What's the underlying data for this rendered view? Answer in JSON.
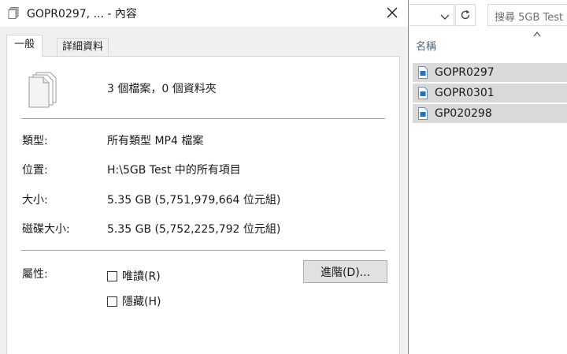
{
  "dialog": {
    "title": "GOPR0297, ... - 內容",
    "tabs": [
      {
        "label": "一般",
        "active": true
      },
      {
        "label": "詳細資料",
        "active": false
      }
    ],
    "summary": "3 個檔案，0 個資料夾",
    "rows": {
      "type": {
        "label": "類型:",
        "value": "所有類型 MP4 檔案"
      },
      "location": {
        "label": "位置:",
        "value": "H:\\5GB Test 中的所有項目"
      },
      "size": {
        "label": "大小:",
        "value": "5.35 GB (5,751,979,664 位元組)"
      },
      "size_on_disk": {
        "label": "磁碟大小:",
        "value": "5.35 GB (5,752,225,792 位元組)"
      }
    },
    "attributes": {
      "label": "屬性:",
      "readonly": {
        "label": "唯讀(R)",
        "checked": false
      },
      "hidden": {
        "label": "隱藏(H)",
        "checked": false
      },
      "advanced_label": "進階(D)..."
    }
  },
  "explorer": {
    "search_placeholder": "搜尋 5GB Test",
    "column_header": "名稱",
    "files": [
      {
        "name": "GOPR0297",
        "selected": true
      },
      {
        "name": "GOPR0301",
        "selected": true
      },
      {
        "name": "GP020298",
        "selected": true
      }
    ],
    "selection_color": "#d9d9d9",
    "file_icon_accent": "#1e72c8"
  }
}
